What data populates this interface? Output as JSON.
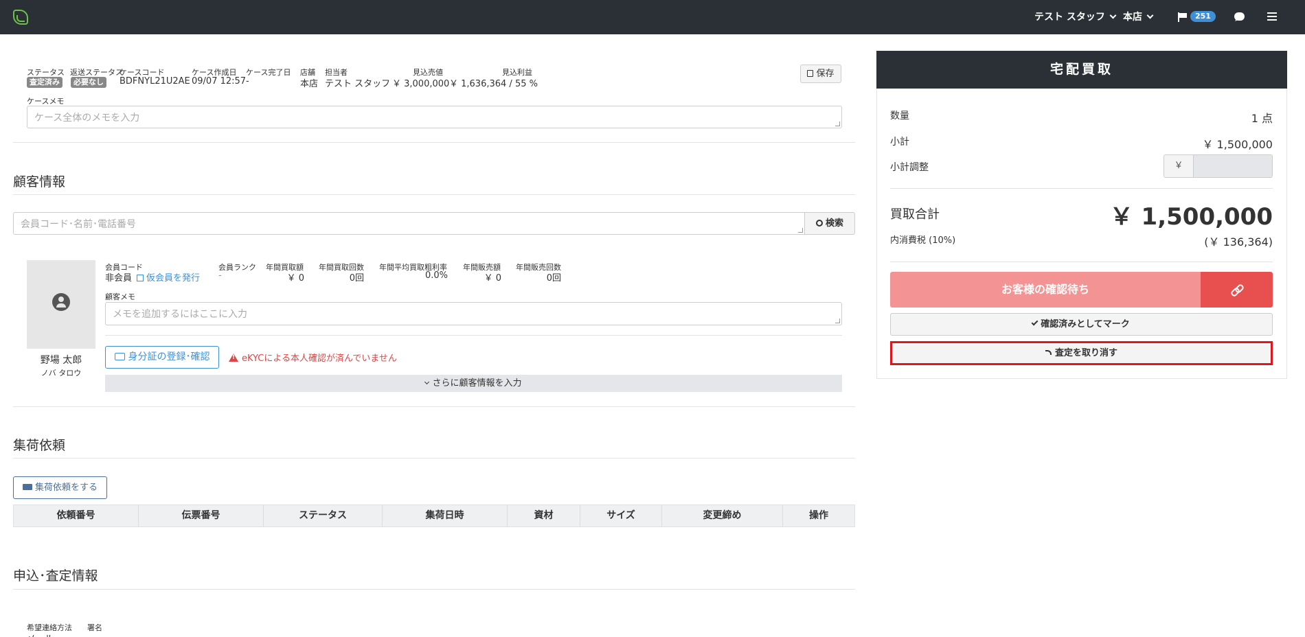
{
  "topbar": {
    "user_label": "テスト スタッフ",
    "store_label": "本店",
    "notification_count": "251"
  },
  "case": {
    "labels": {
      "status": "ステータス",
      "return_status": "返送ステータス",
      "case_code": "ケースコード",
      "created": "ケース作成日",
      "completed": "ケース完了日",
      "store": "店舗",
      "staff": "担当者",
      "expected_sales": "見込売値",
      "expected_profit": "見込利益",
      "memo": "ケースメモ"
    },
    "status": "査定済み",
    "return_status": "必要なし",
    "case_code": "BDFNYL21U2AE",
    "created": "09/07 12:57",
    "completed": "-",
    "store": "本店",
    "staff": "テスト スタッフ",
    "expected_sales": "￥ 3,000,000",
    "expected_profit": "￥ 1,636,364 / 55 %",
    "memo_placeholder": "ケース全体のメモを入力",
    "save_label": "保存"
  },
  "customer": {
    "section_title": "顧客情報",
    "search_placeholder": "会員コード･名前･電話番号",
    "search_label": "検索",
    "name": "野場 太郎",
    "kana": "ノバ タロウ",
    "labels": {
      "member_code": "会員コード",
      "member_rank": "会員ランク",
      "annual_purchase_amount": "年間買取額",
      "annual_purchase_count": "年間買取回数",
      "annual_avg_margin": "年間平均買取粗利率",
      "annual_sales_amount": "年間販売額",
      "annual_sales_count": "年間販売回数",
      "memo": "顧客メモ"
    },
    "member_code": "非会員",
    "issue_temp_member": "仮会員を発行",
    "member_rank": "-",
    "annual_purchase_amount": "￥ 0",
    "annual_purchase_count": "0回",
    "annual_avg_margin": "0.0%",
    "annual_sales_amount": "￥ 0",
    "annual_sales_count": "0回",
    "memo_placeholder": "メモを追加するにはここに入力",
    "id_register_label": "身分証の登録･確認",
    "ekyc_warning": "eKYCによる本人確認が済んでいません",
    "more_info_label": "さらに顧客情報を入力"
  },
  "pickup": {
    "section_title": "集荷依頼",
    "request_button": "集荷依頼をする",
    "columns": [
      "依頼番号",
      "伝票番号",
      "ステータス",
      "集荷日時",
      "資材",
      "サイズ",
      "変更締め",
      "操作"
    ]
  },
  "application": {
    "section_title": "申込･査定情報",
    "labels": {
      "contact_method": "希望連絡方法",
      "signature": "署名"
    },
    "contact_method": "メール"
  },
  "summary": {
    "title": "宅配買取",
    "quantity_label": "数量",
    "quantity": "1 点",
    "subtotal_label": "小計",
    "subtotal": "￥ 1,500,000",
    "adjust_label": "小計調整",
    "adjust_prefix": "￥",
    "total_label": "買取合計",
    "total": "￥ 1,500,000",
    "tax_label": "内消費税 (10%)",
    "tax": "(￥ 136,364)",
    "status_button": "お客様の確認待ち",
    "confirm_button": "確認済みとしてマーク",
    "cancel_button": "査定を取り消す"
  },
  "colors": {
    "topbar": "#2b3036",
    "accent_blue": "#3f8fd8",
    "status_pink": "#f49393",
    "link_red": "#e85050",
    "highlight_red": "#e0161c",
    "warning_red": "#e04444"
  }
}
